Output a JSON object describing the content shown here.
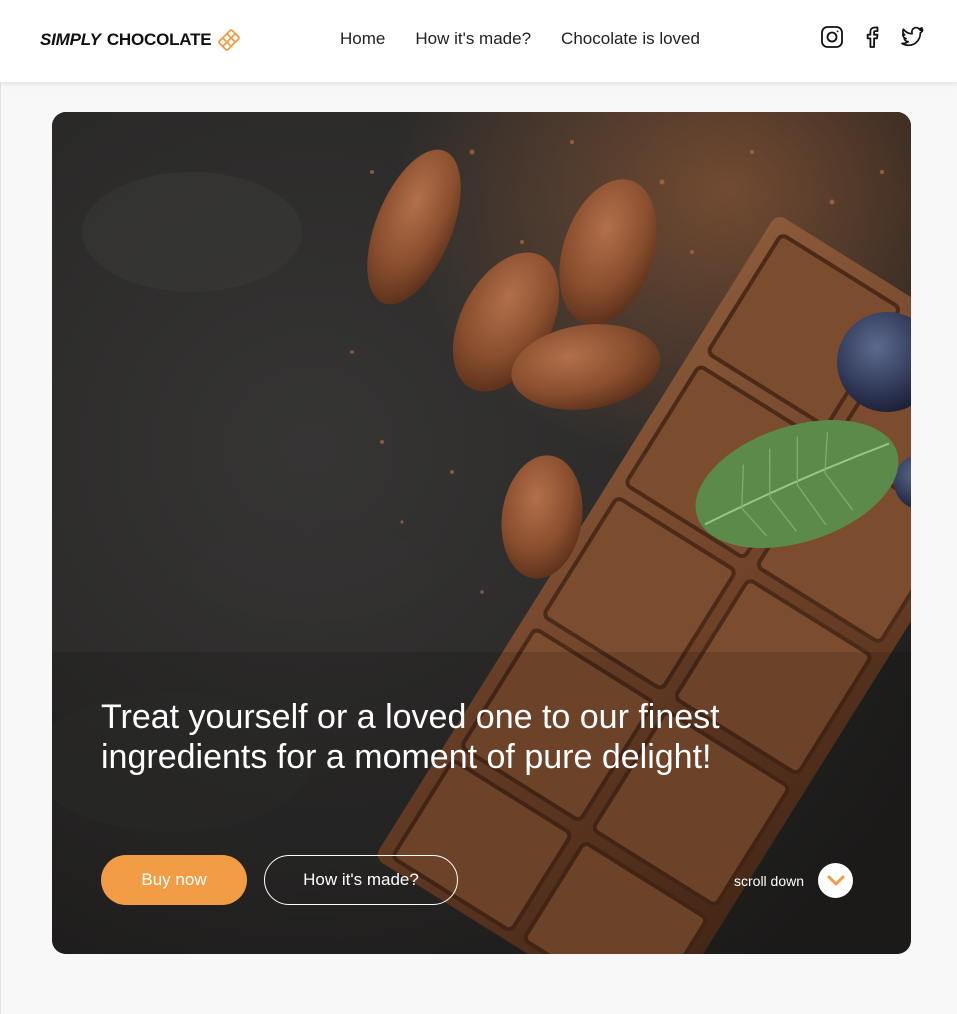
{
  "header": {
    "logo": {
      "word1": "SIMPLY",
      "word2": "CHOCOLATE",
      "icon": "chocolate-bar-icon"
    },
    "nav": [
      {
        "label": "Home"
      },
      {
        "label": "How it's made?"
      },
      {
        "label": "Chocolate is loved"
      }
    ],
    "social": [
      {
        "icon": "instagram-icon"
      },
      {
        "icon": "facebook-icon"
      },
      {
        "icon": "twitter-icon"
      }
    ]
  },
  "hero": {
    "title": "Treat yourself or a loved one to our finest ingredients for a moment of pure delight!",
    "buy_label": "Buy now",
    "how_label": "How it's made?",
    "scroll_label": "scroll down",
    "scroll_icon": "chevron-down-icon"
  },
  "colors": {
    "accent": "#f29d45",
    "header_bg": "#ffffff",
    "page_bg": "#f8f8f8",
    "hero_bg": "#2b2a29"
  }
}
